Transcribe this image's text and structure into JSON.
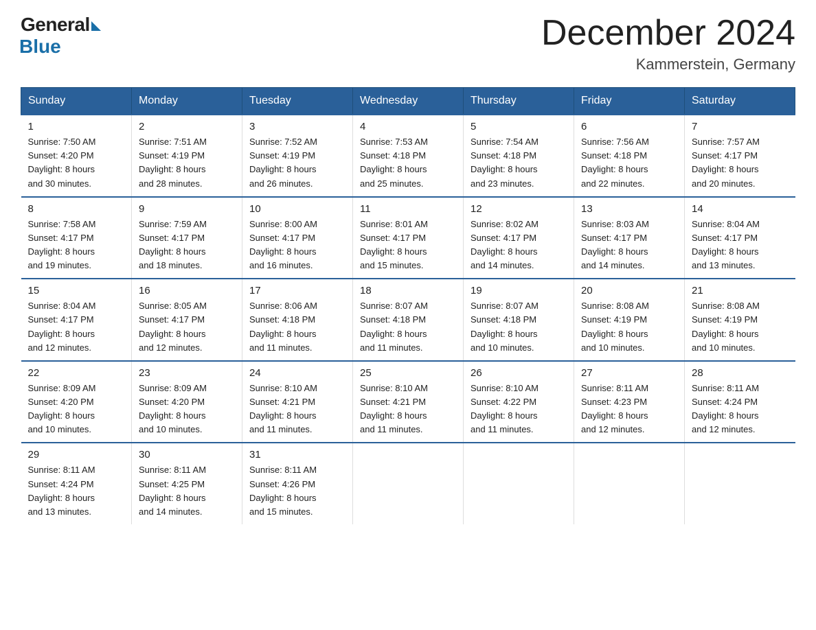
{
  "logo": {
    "general": "General",
    "blue": "Blue"
  },
  "title": {
    "month": "December 2024",
    "location": "Kammerstein, Germany"
  },
  "header_days": [
    "Sunday",
    "Monday",
    "Tuesday",
    "Wednesday",
    "Thursday",
    "Friday",
    "Saturday"
  ],
  "weeks": [
    [
      {
        "day": "1",
        "sunrise": "7:50 AM",
        "sunset": "4:20 PM",
        "daylight": "8 hours and 30 minutes."
      },
      {
        "day": "2",
        "sunrise": "7:51 AM",
        "sunset": "4:19 PM",
        "daylight": "8 hours and 28 minutes."
      },
      {
        "day": "3",
        "sunrise": "7:52 AM",
        "sunset": "4:19 PM",
        "daylight": "8 hours and 26 minutes."
      },
      {
        "day": "4",
        "sunrise": "7:53 AM",
        "sunset": "4:18 PM",
        "daylight": "8 hours and 25 minutes."
      },
      {
        "day": "5",
        "sunrise": "7:54 AM",
        "sunset": "4:18 PM",
        "daylight": "8 hours and 23 minutes."
      },
      {
        "day": "6",
        "sunrise": "7:56 AM",
        "sunset": "4:18 PM",
        "daylight": "8 hours and 22 minutes."
      },
      {
        "day": "7",
        "sunrise": "7:57 AM",
        "sunset": "4:17 PM",
        "daylight": "8 hours and 20 minutes."
      }
    ],
    [
      {
        "day": "8",
        "sunrise": "7:58 AM",
        "sunset": "4:17 PM",
        "daylight": "8 hours and 19 minutes."
      },
      {
        "day": "9",
        "sunrise": "7:59 AM",
        "sunset": "4:17 PM",
        "daylight": "8 hours and 18 minutes."
      },
      {
        "day": "10",
        "sunrise": "8:00 AM",
        "sunset": "4:17 PM",
        "daylight": "8 hours and 16 minutes."
      },
      {
        "day": "11",
        "sunrise": "8:01 AM",
        "sunset": "4:17 PM",
        "daylight": "8 hours and 15 minutes."
      },
      {
        "day": "12",
        "sunrise": "8:02 AM",
        "sunset": "4:17 PM",
        "daylight": "8 hours and 14 minutes."
      },
      {
        "day": "13",
        "sunrise": "8:03 AM",
        "sunset": "4:17 PM",
        "daylight": "8 hours and 14 minutes."
      },
      {
        "day": "14",
        "sunrise": "8:04 AM",
        "sunset": "4:17 PM",
        "daylight": "8 hours and 13 minutes."
      }
    ],
    [
      {
        "day": "15",
        "sunrise": "8:04 AM",
        "sunset": "4:17 PM",
        "daylight": "8 hours and 12 minutes."
      },
      {
        "day": "16",
        "sunrise": "8:05 AM",
        "sunset": "4:17 PM",
        "daylight": "8 hours and 12 minutes."
      },
      {
        "day": "17",
        "sunrise": "8:06 AM",
        "sunset": "4:18 PM",
        "daylight": "8 hours and 11 minutes."
      },
      {
        "day": "18",
        "sunrise": "8:07 AM",
        "sunset": "4:18 PM",
        "daylight": "8 hours and 11 minutes."
      },
      {
        "day": "19",
        "sunrise": "8:07 AM",
        "sunset": "4:18 PM",
        "daylight": "8 hours and 10 minutes."
      },
      {
        "day": "20",
        "sunrise": "8:08 AM",
        "sunset": "4:19 PM",
        "daylight": "8 hours and 10 minutes."
      },
      {
        "day": "21",
        "sunrise": "8:08 AM",
        "sunset": "4:19 PM",
        "daylight": "8 hours and 10 minutes."
      }
    ],
    [
      {
        "day": "22",
        "sunrise": "8:09 AM",
        "sunset": "4:20 PM",
        "daylight": "8 hours and 10 minutes."
      },
      {
        "day": "23",
        "sunrise": "8:09 AM",
        "sunset": "4:20 PM",
        "daylight": "8 hours and 10 minutes."
      },
      {
        "day": "24",
        "sunrise": "8:10 AM",
        "sunset": "4:21 PM",
        "daylight": "8 hours and 11 minutes."
      },
      {
        "day": "25",
        "sunrise": "8:10 AM",
        "sunset": "4:21 PM",
        "daylight": "8 hours and 11 minutes."
      },
      {
        "day": "26",
        "sunrise": "8:10 AM",
        "sunset": "4:22 PM",
        "daylight": "8 hours and 11 minutes."
      },
      {
        "day": "27",
        "sunrise": "8:11 AM",
        "sunset": "4:23 PM",
        "daylight": "8 hours and 12 minutes."
      },
      {
        "day": "28",
        "sunrise": "8:11 AM",
        "sunset": "4:24 PM",
        "daylight": "8 hours and 12 minutes."
      }
    ],
    [
      {
        "day": "29",
        "sunrise": "8:11 AM",
        "sunset": "4:24 PM",
        "daylight": "8 hours and 13 minutes."
      },
      {
        "day": "30",
        "sunrise": "8:11 AM",
        "sunset": "4:25 PM",
        "daylight": "8 hours and 14 minutes."
      },
      {
        "day": "31",
        "sunrise": "8:11 AM",
        "sunset": "4:26 PM",
        "daylight": "8 hours and 15 minutes."
      },
      null,
      null,
      null,
      null
    ]
  ],
  "labels": {
    "sunrise": "Sunrise:",
    "sunset": "Sunset:",
    "daylight": "Daylight:"
  }
}
